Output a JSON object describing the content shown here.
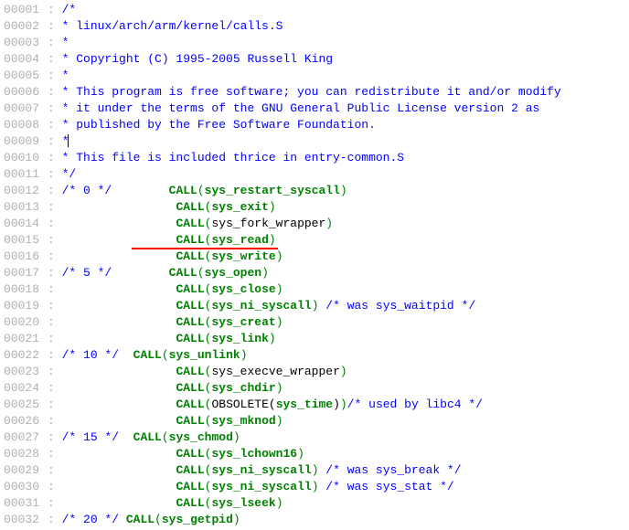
{
  "lines": [
    {
      "num": "00001",
      "type": "comment",
      "text": "/*"
    },
    {
      "num": "00002",
      "type": "comment",
      "text": " *  linux/arch/arm/kernel/calls.S"
    },
    {
      "num": "00003",
      "type": "comment",
      "text": " *"
    },
    {
      "num": "00004",
      "type": "comment",
      "text": " *  Copyright (C) 1995-2005 Russell King"
    },
    {
      "num": "00005",
      "type": "comment",
      "text": " *"
    },
    {
      "num": "00006",
      "type": "comment",
      "text": " * This program is free software; you can redistribute it and/or modify"
    },
    {
      "num": "00007",
      "type": "comment",
      "text": " * it under the terms of the GNU General Public License version 2 as"
    },
    {
      "num": "00008",
      "type": "comment",
      "text": " * published by the Free Software Foundation."
    },
    {
      "num": "00009",
      "type": "comment-cursor",
      "text": " *"
    },
    {
      "num": "00010",
      "type": "comment",
      "text": " *  This file is included thrice in entry-common.S"
    },
    {
      "num": "00011",
      "type": "comment",
      "text": " */"
    },
    {
      "num": "00012",
      "type": "call",
      "marker": "/* 0 */",
      "indent": "        ",
      "call": "CALL",
      "open": "(",
      "fn": "sys_restart_syscall",
      "fnstyle": "green",
      "close": ")"
    },
    {
      "num": "00013",
      "type": "call",
      "indent": "                ",
      "call": "CALL",
      "open": "(",
      "fn": "sys_exit",
      "fnstyle": "green",
      "close": ")"
    },
    {
      "num": "00014",
      "type": "call",
      "indent": "                ",
      "call": "CALL",
      "open": "(",
      "fn": "sys_fork_wrapper",
      "fnstyle": "black",
      "close": ")"
    },
    {
      "num": "00015",
      "type": "call",
      "indent": "                ",
      "call": "CALL",
      "open": "(",
      "fn": "sys_read",
      "fnstyle": "green",
      "close": ")",
      "redline": true
    },
    {
      "num": "00016",
      "type": "call",
      "indent": "                ",
      "call": "CALL",
      "open": "(",
      "fn": "sys_write",
      "fnstyle": "green",
      "close": ")"
    },
    {
      "num": "00017",
      "type": "call",
      "marker": "/* 5 */",
      "indent": "        ",
      "call": "CALL",
      "open": "(",
      "fn": "sys_open",
      "fnstyle": "green",
      "close": ")"
    },
    {
      "num": "00018",
      "type": "call",
      "indent": "                ",
      "call": "CALL",
      "open": "(",
      "fn": "sys_close",
      "fnstyle": "green",
      "close": ")"
    },
    {
      "num": "00019",
      "type": "call",
      "indent": "                ",
      "call": "CALL",
      "open": "(",
      "fn": "sys_ni_syscall",
      "fnstyle": "green",
      "close": ")",
      "tail": "        /* was sys_waitpid */"
    },
    {
      "num": "00020",
      "type": "call",
      "indent": "                ",
      "call": "CALL",
      "open": "(",
      "fn": "sys_creat",
      "fnstyle": "green",
      "close": ")"
    },
    {
      "num": "00021",
      "type": "call",
      "indent": "                ",
      "call": "CALL",
      "open": "(",
      "fn": "sys_link",
      "fnstyle": "green",
      "close": ")"
    },
    {
      "num": "00022",
      "type": "call",
      "marker": "/* 10 */",
      "indent": "  ",
      "call": "CALL",
      "open": "(",
      "fn": "sys_unlink",
      "fnstyle": "green",
      "close": ")"
    },
    {
      "num": "00023",
      "type": "call",
      "indent": "                ",
      "call": "CALL",
      "open": "(",
      "fn": "sys_execve_wrapper",
      "fnstyle": "black",
      "close": ")"
    },
    {
      "num": "00024",
      "type": "call",
      "indent": "                ",
      "call": "CALL",
      "open": "(",
      "fn": "sys_chdir",
      "fnstyle": "green",
      "close": ")"
    },
    {
      "num": "00025",
      "type": "obsolete",
      "indent": "                ",
      "call": "CALL",
      "open": "(",
      "obs": "OBSOLETE(",
      "fn": "sys_time",
      "fnstyle": "green",
      "obsclose": ")",
      "close": ")",
      "tail": "/* used by libc4 */"
    },
    {
      "num": "00026",
      "type": "call",
      "indent": "                ",
      "call": "CALL",
      "open": "(",
      "fn": "sys_mknod",
      "fnstyle": "green",
      "close": ")"
    },
    {
      "num": "00027",
      "type": "call",
      "marker": "/* 15 */",
      "indent": "  ",
      "call": "CALL",
      "open": "(",
      "fn": "sys_chmod",
      "fnstyle": "green",
      "close": ")"
    },
    {
      "num": "00028",
      "type": "call",
      "indent": "                ",
      "call": "CALL",
      "open": "(",
      "fn": "sys_lchown16",
      "fnstyle": "green",
      "close": ")"
    },
    {
      "num": "00029",
      "type": "call",
      "indent": "                ",
      "call": "CALL",
      "open": "(",
      "fn": "sys_ni_syscall",
      "fnstyle": "green",
      "close": ")",
      "tail": "        /* was sys_break */"
    },
    {
      "num": "00030",
      "type": "call",
      "indent": "                ",
      "call": "CALL",
      "open": "(",
      "fn": "sys_ni_syscall",
      "fnstyle": "green",
      "close": ")",
      "tail": "        /* was sys_stat */"
    },
    {
      "num": "00031",
      "type": "call",
      "indent": "                ",
      "call": "CALL",
      "open": "(",
      "fn": "sys_lseek",
      "fnstyle": "green",
      "close": ")"
    },
    {
      "num": "00032",
      "type": "call",
      "marker": "/* 20 */",
      "indent": " ",
      "call": "CALL",
      "open": "(",
      "fn": "sys_getpid",
      "fnstyle": "green",
      "close": ")"
    }
  ]
}
